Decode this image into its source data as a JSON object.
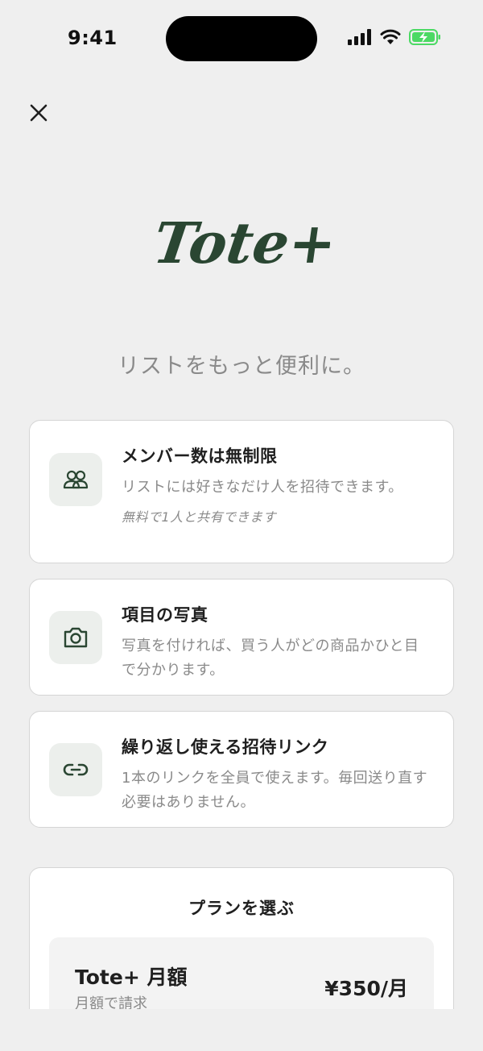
{
  "status_bar": {
    "time": "9:41"
  },
  "header": {
    "logo_text": "Tote+"
  },
  "tagline": "リストをもっと便利に。",
  "features": [
    {
      "icon": "people-icon",
      "title": "メンバー数は無制限",
      "description": "リストには好きなだけ人を招待できます。",
      "note": "無料で1人と共有できます"
    },
    {
      "icon": "camera-icon",
      "title": "項目の写真",
      "description": "写真を付ければ、買う人がどの商品かひと目で分かります。"
    },
    {
      "icon": "link-icon",
      "title": "繰り返し使える招待リンク",
      "description": "1本のリンクを全員で使えます。毎回送り直す必要はありません。"
    }
  ],
  "plans": {
    "title": "プランを選ぶ",
    "options": [
      {
        "name": "Tote+ 月額",
        "billing": "月額で請求",
        "price": "¥350/月"
      }
    ]
  },
  "colors": {
    "brand": "#2a4632",
    "background": "#efefef",
    "battery": "#4cd964"
  }
}
